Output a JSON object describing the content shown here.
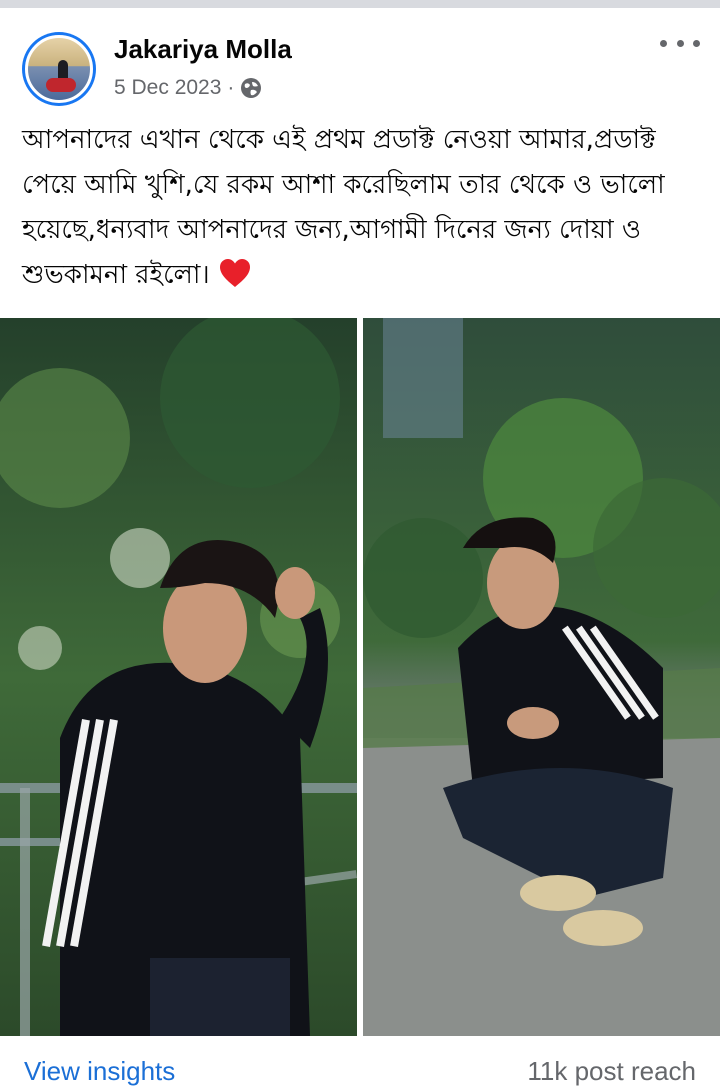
{
  "post": {
    "author": "Jakariya Molla",
    "date": "5 Dec 2023",
    "separator": "·",
    "privacy_icon": "globe-icon",
    "text": "আপনাদের এখান থেকে এই প্রথম প্রডাক্ট নেওয়া আমার,প্রডাক্ট পেয়ে আমি খুশি,যে রকম আশা করেছিলাম তার থেকে ও ভালো হয়েছে,ধন্যবাদ আপনাদের জন্য,আগামী দিনের জন্য দোয়া ও শুভকামনা রইলো।",
    "text_end_icon": "red-heart-icon"
  },
  "footer": {
    "insights_label": "View insights",
    "reach_label": "11k post reach"
  },
  "colors": {
    "link_blue": "#1b6fd6",
    "secondary_text": "#65676b",
    "heart_red": "#e8202a"
  }
}
